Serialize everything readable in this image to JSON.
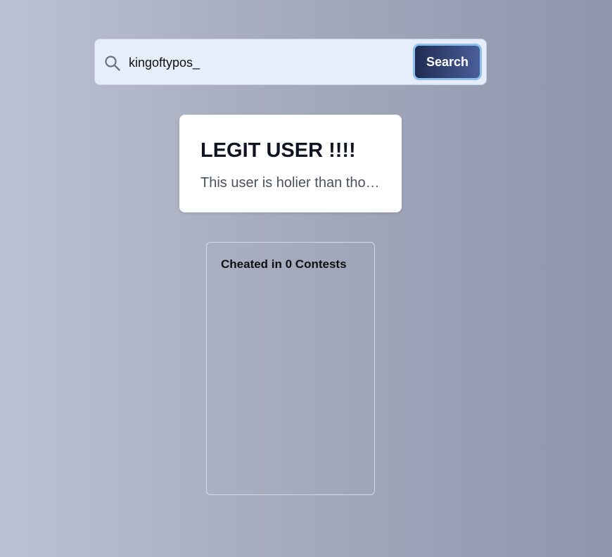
{
  "search": {
    "value": "kingoftypos_",
    "button_label": "Search",
    "icon": "search-icon"
  },
  "status_card": {
    "title": "LEGIT USER !!!!",
    "description": "This user is holier than thou..."
  },
  "contests": {
    "title": "Cheated in 0 Contests",
    "items": []
  },
  "colors": {
    "button_gradient_start": "#1f2b52",
    "button_gradient_end": "#4a5f9a",
    "button_focus_ring": "#8ec0f2",
    "search_bar_bg": "#e6eefb",
    "card_bg": "#ffffff"
  }
}
